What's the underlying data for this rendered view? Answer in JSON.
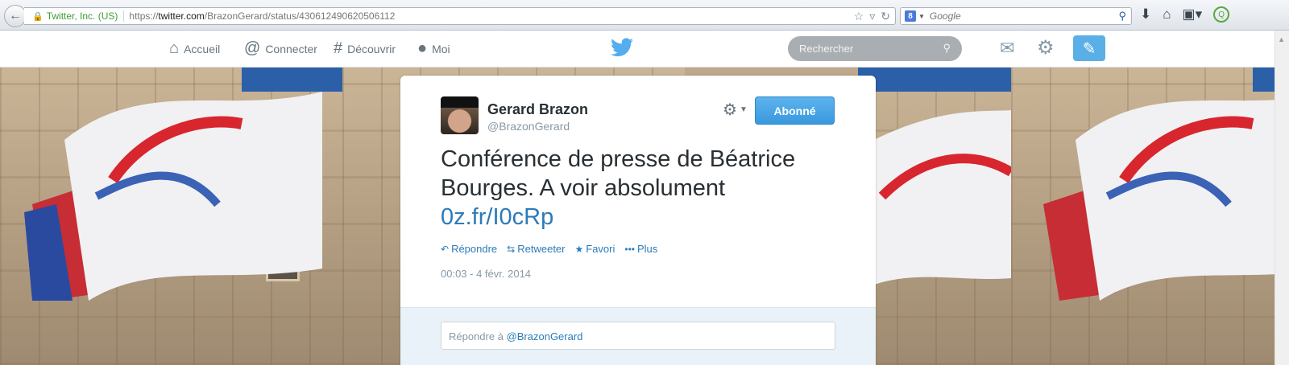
{
  "browser": {
    "identity": "Twitter, Inc. (US)",
    "url_prefix": "https://",
    "url_host": "twitter.com",
    "url_path": "/BrazonGerard/status/430612490620506112",
    "search_engine_placeholder": "Google"
  },
  "nav": {
    "home": "Accueil",
    "connect": "Connecter",
    "discover": "Découvrir",
    "me": "Moi",
    "search_placeholder": "Rechercher"
  },
  "tweet": {
    "author_name": "Gerard Brazon",
    "author_handle": "@BrazonGerard",
    "follow_label": "Abonné",
    "text": "Conférence de presse de Béatrice Bourges. A voir absolument ",
    "link_text": "0z.fr/I0cRp",
    "actions": {
      "reply": "Répondre",
      "retweet": "Retweeter",
      "favorite": "Favori",
      "more": "Plus"
    },
    "timestamp": "00:03 - 4 févr. 2014",
    "reply_prompt": "Répondre à ",
    "reply_mention": "@BrazonGerard"
  },
  "colors": {
    "link": "#2b7bb9",
    "follow_button": "#4aa3e6",
    "identity_green": "#3d9c35"
  }
}
